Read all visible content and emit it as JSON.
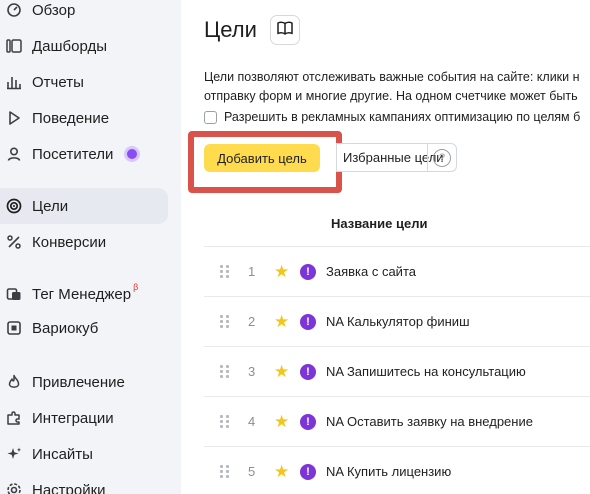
{
  "sidebar": {
    "items": [
      {
        "label": "Обзор",
        "icon": "overview-icon"
      },
      {
        "label": "Дашборды",
        "icon": "dashboards-icon"
      },
      {
        "label": "Отчеты",
        "icon": "reports-icon"
      },
      {
        "label": "Поведение",
        "icon": "play-icon"
      },
      {
        "label": "Посетители",
        "icon": "user-icon"
      },
      {
        "label": "Цели",
        "icon": "target-icon"
      },
      {
        "label": "Конверсии",
        "icon": "percent-icon"
      },
      {
        "label": "Тег Менеджер",
        "icon": "tag-icon",
        "badge": "β"
      },
      {
        "label": "Вариокуб",
        "icon": "variocube-icon"
      },
      {
        "label": "Привлечение",
        "icon": "fire-icon"
      },
      {
        "label": "Интеграции",
        "icon": "puzzle-icon"
      },
      {
        "label": "Инсайты",
        "icon": "sparkle-icon"
      },
      {
        "label": "Настройки",
        "icon": "gear-icon"
      }
    ],
    "active": "Цели",
    "accent_dot_color": "#8a4cf5"
  },
  "main": {
    "title": "Цели",
    "description_line1": "Цели позволяют отслеживать важные события на сайте: клики н",
    "description_line2": "отправку форм и многие другие. На одном счетчике может быть",
    "checkbox_label": "Разрешить в рекламных кампаниях оптимизацию по целям б",
    "add_button": "Добавить цель",
    "favorites_button": "Избранные цели",
    "help": "?",
    "column_header": "Название цели",
    "goals": [
      {
        "num": "1",
        "name": "Заявка с сайта"
      },
      {
        "num": "2",
        "name": "NA Калькулятор финиш"
      },
      {
        "num": "3",
        "name": "NA Запишитесь на консультацию"
      },
      {
        "num": "4",
        "name": "NA Оставить заявку на внедрение"
      },
      {
        "num": "5",
        "name": "NA Купить лицензию"
      }
    ]
  },
  "colors": {
    "accent_yellow": "#ffdb4d",
    "highlight_red": "#d9534a",
    "warning_purple": "#7b35d8",
    "star": "#f5c518"
  }
}
